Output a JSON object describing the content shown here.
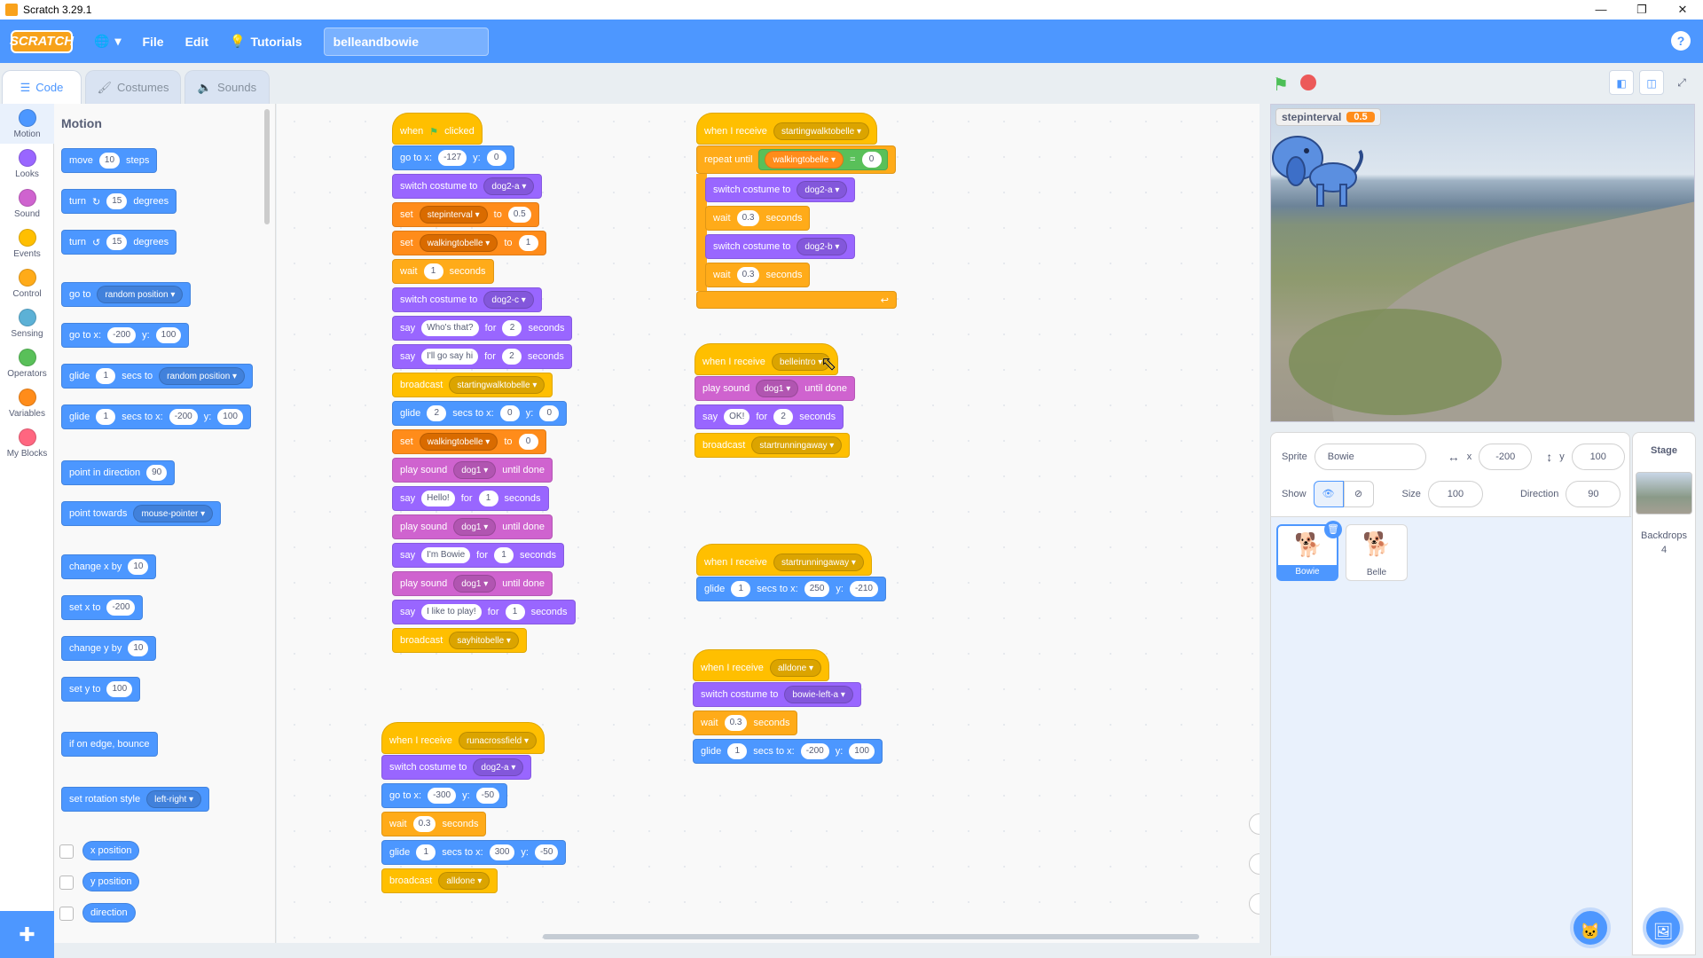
{
  "window": {
    "title": "Scratch 3.29.1"
  },
  "menu": {
    "logo": "SCRATCH",
    "file": "File",
    "edit": "Edit",
    "tutorials": "Tutorials",
    "project_title": "belleandbowie"
  },
  "tabs": {
    "code": "Code",
    "costumes": "Costumes",
    "sounds": "Sounds"
  },
  "categories": [
    "Motion",
    "Looks",
    "Sound",
    "Events",
    "Control",
    "Sensing",
    "Operators",
    "Variables",
    "My Blocks"
  ],
  "category_colors": [
    "#4c97ff",
    "#9966ff",
    "#cf63cf",
    "#ffbf00",
    "#ffab19",
    "#5cb1d6",
    "#59c059",
    "#ff8c1a",
    "#ff6680"
  ],
  "palette": {
    "heading": "Motion",
    "move": {
      "a": "move",
      "v": "10",
      "b": "steps"
    },
    "turn_right": {
      "a": "turn",
      "v": "15",
      "b": "degrees"
    },
    "turn_left": {
      "a": "turn",
      "v": "15",
      "b": "degrees"
    },
    "goto": {
      "a": "go to",
      "dd": "random position"
    },
    "gotoxy": {
      "a": "go to x:",
      "x": "-200",
      "b": "y:",
      "y": "100"
    },
    "glide_to": {
      "a": "glide",
      "v": "1",
      "b": "secs to",
      "dd": "random position"
    },
    "glide_xy": {
      "a": "glide",
      "v": "1",
      "b": "secs to x:",
      "x": "-200",
      "c": "y:",
      "y": "100"
    },
    "point_dir": {
      "a": "point in direction",
      "v": "90"
    },
    "point_towards": {
      "a": "point towards",
      "dd": "mouse-pointer"
    },
    "change_x": {
      "a": "change x by",
      "v": "10"
    },
    "set_x": {
      "a": "set x to",
      "v": "-200"
    },
    "change_y": {
      "a": "change y by",
      "v": "10"
    },
    "set_y": {
      "a": "set y to",
      "v": "100"
    },
    "bounce": {
      "a": "if on edge, bounce"
    },
    "rotation": {
      "a": "set rotation style",
      "dd": "left-right"
    },
    "xpos": "x position",
    "ypos": "y position",
    "direction": "direction"
  },
  "scripts": {
    "s1": {
      "when": "when",
      "clicked": "clicked",
      "goto": {
        "a": "go to x:",
        "x": "-127",
        "b": "y:",
        "y": "0"
      },
      "costume1": {
        "a": "switch costume to",
        "dd": "dog2-a"
      },
      "set1": {
        "a": "set",
        "dd": "stepinterval",
        "b": "to",
        "v": "0.5"
      },
      "set2": {
        "a": "set",
        "dd": "walkingtobelle",
        "b": "to",
        "v": "1"
      },
      "wait1": {
        "a": "wait",
        "v": "1",
        "b": "seconds"
      },
      "costume2": {
        "a": "switch costume to",
        "dd": "dog2-c"
      },
      "say1": {
        "a": "say",
        "t": "Who's that?",
        "b": "for",
        "v": "2",
        "c": "seconds"
      },
      "say2": {
        "a": "say",
        "t": "I'll go say hi",
        "b": "for",
        "v": "2",
        "c": "seconds"
      },
      "bc1": {
        "a": "broadcast",
        "dd": "startingwalktobelle"
      },
      "glide": {
        "a": "glide",
        "v": "2",
        "b": "secs to x:",
        "x": "0",
        "c": "y:",
        "y": "0"
      },
      "set3": {
        "a": "set",
        "dd": "walkingtobelle",
        "b": "to",
        "v": "0"
      },
      "snd1": {
        "a": "play sound",
        "dd": "dog1",
        "b": "until done"
      },
      "say3": {
        "a": "say",
        "t": "Hello!",
        "b": "for",
        "v": "1",
        "c": "seconds"
      },
      "snd2": {
        "a": "play sound",
        "dd": "dog1",
        "b": "until done"
      },
      "say4": {
        "a": "say",
        "t": "I'm Bowie",
        "b": "for",
        "v": "1",
        "c": "seconds"
      },
      "snd3": {
        "a": "play sound",
        "dd": "dog1",
        "b": "until done"
      },
      "say5": {
        "a": "say",
        "t": "I like to play!",
        "b": "for",
        "v": "1",
        "c": "seconds"
      },
      "bc2": {
        "a": "broadcast",
        "dd": "sayhitobelle"
      }
    },
    "s2": {
      "hat": {
        "a": "when I receive",
        "dd": "startingwalktobelle"
      },
      "repeat": {
        "a": "repeat until",
        "var": "walkingtobelle",
        "op": "=",
        "v": "0"
      },
      "c1": {
        "a": "switch costume to",
        "dd": "dog2-a"
      },
      "w1": {
        "a": "wait",
        "v": "0.3",
        "b": "seconds"
      },
      "c2": {
        "a": "switch costume to",
        "dd": "dog2-b"
      },
      "w2": {
        "a": "wait",
        "v": "0.3",
        "b": "seconds"
      }
    },
    "s3": {
      "hat": {
        "a": "when I receive",
        "dd": "belleintro"
      },
      "snd": {
        "a": "play sound",
        "dd": "dog1",
        "b": "until done"
      },
      "say": {
        "a": "say",
        "t": "OK!",
        "b": "for",
        "v": "2",
        "c": "seconds"
      },
      "bc": {
        "a": "broadcast",
        "dd": "startrunningaway"
      }
    },
    "s4": {
      "hat": {
        "a": "when I receive",
        "dd": "startrunningaway"
      },
      "glide": {
        "a": "glide",
        "v": "1",
        "b": "secs to x:",
        "x": "250",
        "c": "y:",
        "y": "-210"
      }
    },
    "s5": {
      "hat": {
        "a": "when I receive",
        "dd": "alldone"
      },
      "c": {
        "a": "switch costume to",
        "dd": "bowie-left-a"
      },
      "w": {
        "a": "wait",
        "v": "0.3",
        "b": "seconds"
      },
      "glide": {
        "a": "glide",
        "v": "1",
        "b": "secs to x:",
        "x": "-200",
        "c": "y:",
        "y": "100"
      }
    },
    "s6": {
      "hat": {
        "a": "when I receive",
        "dd": "runacrossfield"
      },
      "c": {
        "a": "switch costume to",
        "dd": "dog2-a"
      },
      "goto": {
        "a": "go to x:",
        "x": "-300",
        "b": "y:",
        "y": "-50"
      },
      "w": {
        "a": "wait",
        "v": "0.3",
        "b": "seconds"
      },
      "glide": {
        "a": "glide",
        "v": "1",
        "b": "secs to x:",
        "x": "300",
        "c": "y:",
        "y": "-50"
      },
      "bc": {
        "a": "broadcast",
        "dd": "alldone"
      }
    }
  },
  "stage": {
    "monitor_name": "stepinterval",
    "monitor_value": "0.5"
  },
  "sprite_info": {
    "sprite_label": "Sprite",
    "sprite_name": "Bowie",
    "x_label": "x",
    "x": "-200",
    "y_label": "y",
    "y": "100",
    "show_label": "Show",
    "size_label": "Size",
    "size": "100",
    "direction_label": "Direction",
    "direction": "90"
  },
  "sprites": [
    "Bowie",
    "Belle"
  ],
  "stage_pane": {
    "title": "Stage",
    "backdrops_label": "Backdrops",
    "backdrops_count": "4"
  }
}
